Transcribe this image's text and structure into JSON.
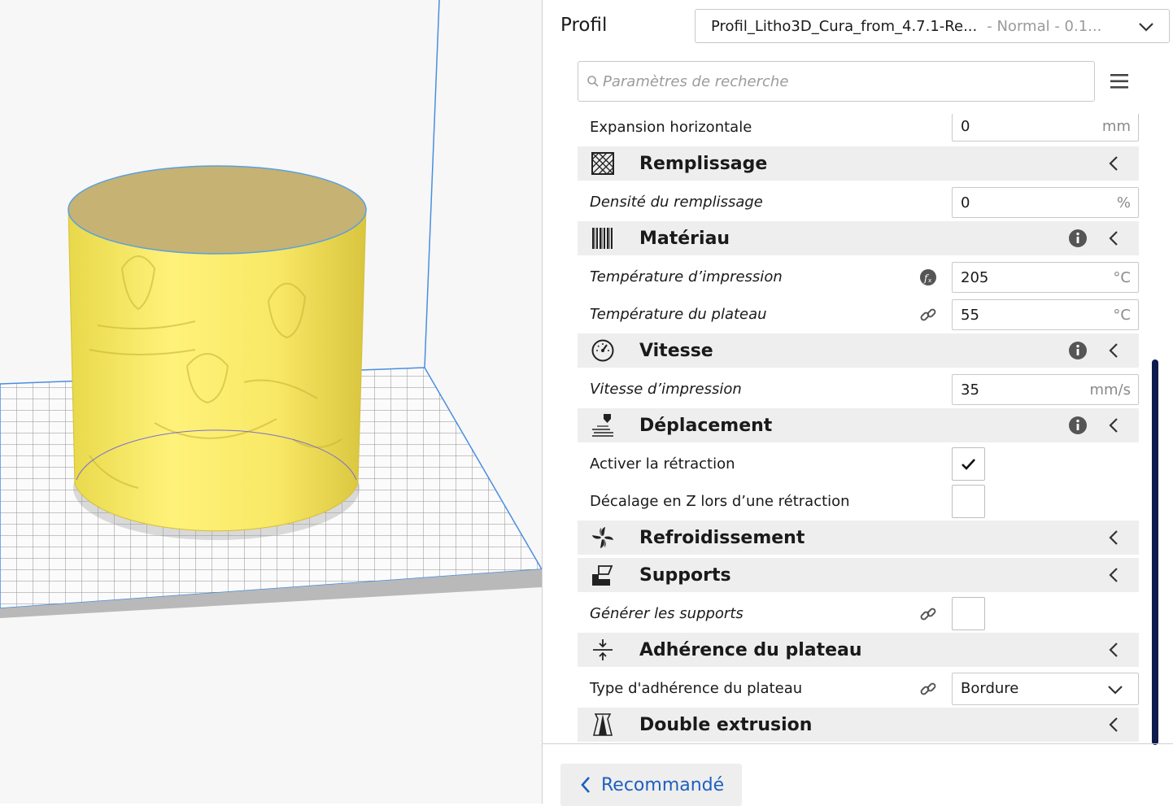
{
  "header": {
    "profile_label": "Profil",
    "profile_value": "Profil_Litho3D_Cura_from_4.7.1-Re...",
    "profile_sub": "- Normal - 0.1..."
  },
  "search": {
    "placeholder": "Paramètres de recherche"
  },
  "settings": {
    "expansion": {
      "label": "Expansion horizontale",
      "value": "0",
      "unit": "mm"
    },
    "infill": {
      "title": "Remplissage",
      "icon": "infill-icon"
    },
    "infill_density": {
      "label": "Densité du remplissage",
      "value": "0",
      "unit": "%"
    },
    "material": {
      "title": "Matériau",
      "icon": "material-icon"
    },
    "print_temp": {
      "label": "Température d’impression",
      "value": "205",
      "unit": "°C",
      "icon": "function-icon"
    },
    "bed_temp": {
      "label": "Température du plateau",
      "value": "55",
      "unit": "°C",
      "icon": "link-icon"
    },
    "speed": {
      "title": "Vitesse",
      "icon": "speedometer-icon"
    },
    "print_speed": {
      "label": "Vitesse d’impression",
      "value": "35",
      "unit": "mm/s"
    },
    "travel": {
      "title": "Déplacement",
      "icon": "travel-icon"
    },
    "retraction": {
      "label": "Activer la rétraction",
      "checked": true
    },
    "zhop": {
      "label": "Décalage en Z lors d’une rétraction",
      "checked": false
    },
    "cooling": {
      "title": "Refroidissement",
      "icon": "fan-icon"
    },
    "supports": {
      "title": "Supports",
      "icon": "supports-icon"
    },
    "gen_supports": {
      "label": "Générer les supports",
      "checked": false,
      "icon": "link-icon"
    },
    "adhesion": {
      "title": "Adhérence du plateau",
      "icon": "adhesion-icon"
    },
    "adhesion_type": {
      "label": "Type d'adhérence du plateau",
      "value": "Bordure",
      "icon": "link-icon"
    },
    "dual": {
      "title": "Double extrusion",
      "icon": "dual-extrusion-icon"
    }
  },
  "footer": {
    "recommended_label": "Recommandé"
  },
  "colors": {
    "model": "#f5e873",
    "accent": "#1f5fbf",
    "scrollbar": "#0d1b4d",
    "category_bg": "#eeeeee"
  }
}
